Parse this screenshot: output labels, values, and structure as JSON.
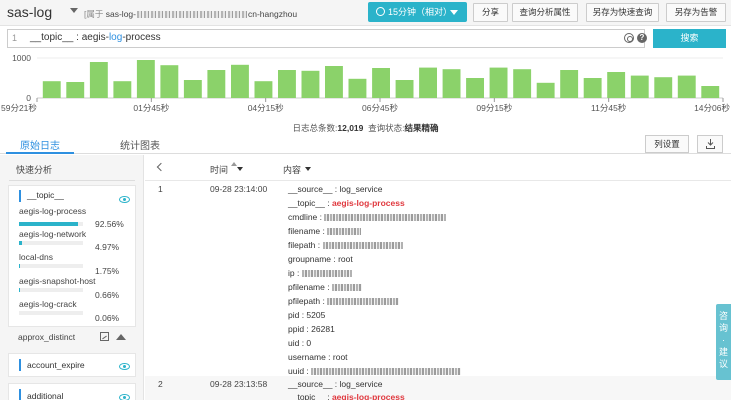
{
  "header": {
    "logstore_name": "sas-log",
    "belong_label": "[属于",
    "project_prefix": "sas-log-",
    "region_suffix": "cn-hangzhou",
    "time_range": "15分钟（相对）",
    "buttons": [
      "分享",
      "查询分析属性",
      "另存为快速查询",
      "另存为告警"
    ]
  },
  "search": {
    "line_number": "1",
    "query_field": "__topic__",
    "query_sep": " : aegis-",
    "query_kw": "log",
    "query_tail": "-process",
    "button": "搜索"
  },
  "histogram": {
    "y_ticks": [
      "1000",
      "0"
    ],
    "x_ticks": [
      "59分21秒",
      "01分45秒",
      "04分15秒",
      "06分45秒",
      "09分15秒",
      "11分45秒",
      "14分06秒"
    ],
    "values": [
      420,
      400,
      900,
      420,
      950,
      820,
      450,
      700,
      830,
      420,
      700,
      680,
      800,
      480,
      750,
      450,
      760,
      720,
      500,
      760,
      720,
      380,
      700,
      500,
      650,
      560,
      520,
      560,
      300
    ]
  },
  "summary": {
    "count_label": "日志总条数:",
    "count_value": "12,019",
    "status_label": "查询状态:",
    "status_value": "结果精确"
  },
  "tabs": {
    "raw_logs": "原始日志",
    "stats_chart": "统计图表",
    "column_settings": "列设置"
  },
  "quick_analysis": {
    "title": "快速分析",
    "topic_field": "__topic__",
    "values": [
      {
        "name": "aegis-log-process",
        "pct": "92.56%",
        "ratio": 0.9256
      },
      {
        "name": "aegis-log-network",
        "pct": "4.97%",
        "ratio": 0.0497
      },
      {
        "name": "local-dns",
        "pct": "1.75%",
        "ratio": 0.0175
      },
      {
        "name": "aegis-snapshot-host",
        "pct": "0.66%",
        "ratio": 0.0066
      },
      {
        "name": "aegis-log-crack",
        "pct": "0.06%",
        "ratio": 0.0006
      }
    ],
    "approx_distinct": "approx_distinct",
    "field_account_expire": "account_expire",
    "field_additional": "additional"
  },
  "table": {
    "col_time": "时间",
    "col_content": "内容",
    "rows": [
      {
        "num": "1",
        "time": "09-28 23:14:00",
        "fields": {
          "source": "__source__ : log_service",
          "topic_key": "__topic__ : ",
          "topic_val": "aegis-log-process",
          "cmdline": "cmdline : ",
          "filename": "filename : ",
          "filepath": "filepath : ",
          "groupname": "groupname : root",
          "ip": "ip : ",
          "pfilename": "pfilename : ",
          "pfilepath": "pfilepath : ",
          "pid": "pid : 5205",
          "ppid": "ppid : 26281",
          "uid": "uid : 0",
          "username": "username : root",
          "uuid": "uuid : "
        }
      },
      {
        "num": "2",
        "time": "09-28 23:13:58",
        "fields": {
          "source": "__source__ : log_service",
          "topic_key": "__topic__ : ",
          "topic_val": "aegis-log-process"
        }
      }
    ]
  },
  "feedback": "咨询·建议",
  "colors": {
    "accent": "#2bb3ca",
    "link": "#2e90e0",
    "bar": "#8bd26a",
    "highlight_red": "#e0383e"
  }
}
